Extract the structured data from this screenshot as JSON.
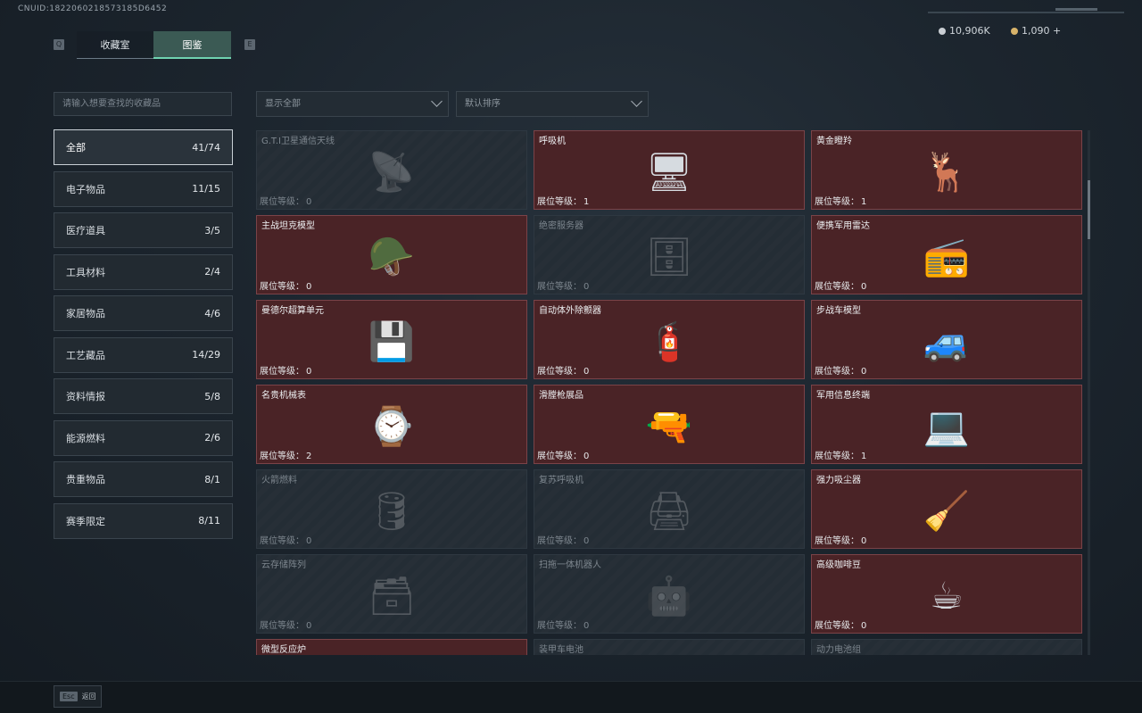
{
  "header": {
    "uid": "CNUID:1822060218573185D6452",
    "tabs": [
      {
        "key": "Q",
        "label": "收藏室"
      },
      {
        "label": "图鉴",
        "key": "E"
      }
    ],
    "currency": [
      {
        "icon": "silver-coin-icon",
        "value": "10,906K",
        "color": "#c9ced3"
      },
      {
        "icon": "gold-coin-icon",
        "value": "1,090 +",
        "color": "#d7b36a"
      }
    ]
  },
  "search": {
    "placeholder": "请输入想要查找的收藏品"
  },
  "filters": {
    "display": "显示全部",
    "sort": "默认排序"
  },
  "categories": [
    {
      "label": "全部",
      "count": "41/74"
    },
    {
      "label": "电子物品",
      "count": "11/15"
    },
    {
      "label": "医疗道具",
      "count": "3/5"
    },
    {
      "label": "工具材料",
      "count": "2/4"
    },
    {
      "label": "家居物品",
      "count": "4/6"
    },
    {
      "label": "工艺藏品",
      "count": "14/29"
    },
    {
      "label": "资料情报",
      "count": "5/8"
    },
    {
      "label": "能源燃料",
      "count": "2/6"
    },
    {
      "label": "贵重物品",
      "count": "8/1"
    },
    {
      "label": "赛季限定",
      "count": "8/11"
    }
  ],
  "level_label": "展位等级：",
  "items": [
    {
      "name": "G.T.I卫星通信天线",
      "level": "0",
      "owned": false,
      "icon": "satellite-antenna-icon"
    },
    {
      "name": "呼吸机",
      "level": "1",
      "owned": true,
      "icon": "ventilator-icon"
    },
    {
      "name": "黄金瞪羚",
      "level": "1",
      "owned": true,
      "icon": "golden-gazelle-icon"
    },
    {
      "name": "主战坦克模型",
      "level": "0",
      "owned": true,
      "icon": "tank-model-icon"
    },
    {
      "name": "绝密服务器",
      "level": "0",
      "owned": false,
      "icon": "server-icon"
    },
    {
      "name": "便携军用雷达",
      "level": "0",
      "owned": true,
      "icon": "radar-icon"
    },
    {
      "name": "曼德尔超算单元",
      "level": "0",
      "owned": true,
      "icon": "supercomputer-unit-icon"
    },
    {
      "name": "自动体外除颤器",
      "level": "0",
      "owned": true,
      "icon": "defibrillator-icon"
    },
    {
      "name": "步战车模型",
      "level": "0",
      "owned": true,
      "icon": "ifv-model-icon"
    },
    {
      "name": "名贵机械表",
      "level": "2",
      "owned": true,
      "icon": "watch-icon"
    },
    {
      "name": "滑膛枪展品",
      "level": "0",
      "owned": true,
      "icon": "musket-icon"
    },
    {
      "name": "军用信息终端",
      "level": "1",
      "owned": true,
      "icon": "terminal-icon"
    },
    {
      "name": "火箭燃料",
      "level": "0",
      "owned": false,
      "icon": "rocket-fuel-icon"
    },
    {
      "name": "复苏呼吸机",
      "level": "0",
      "owned": false,
      "icon": "resuscitator-icon"
    },
    {
      "name": "强力吸尘器",
      "level": "0",
      "owned": true,
      "icon": "vacuum-icon"
    },
    {
      "name": "云存储阵列",
      "level": "0",
      "owned": false,
      "icon": "storage-array-icon"
    },
    {
      "name": "扫拖一体机器人",
      "level": "0",
      "owned": false,
      "icon": "robot-vacuum-icon"
    },
    {
      "name": "高级咖啡豆",
      "level": "0",
      "owned": true,
      "icon": "coffee-bag-icon"
    },
    {
      "name": "微型反应炉",
      "level": "",
      "owned": true,
      "icon": "reactor-icon"
    },
    {
      "name": "装甲车电池",
      "level": "",
      "owned": false,
      "icon": "battery-icon"
    },
    {
      "name": "动力电池组",
      "level": "",
      "owned": false,
      "icon": "battery-pack-icon"
    }
  ],
  "footer": {
    "esc_key": "Esc",
    "esc_label": "返回"
  }
}
